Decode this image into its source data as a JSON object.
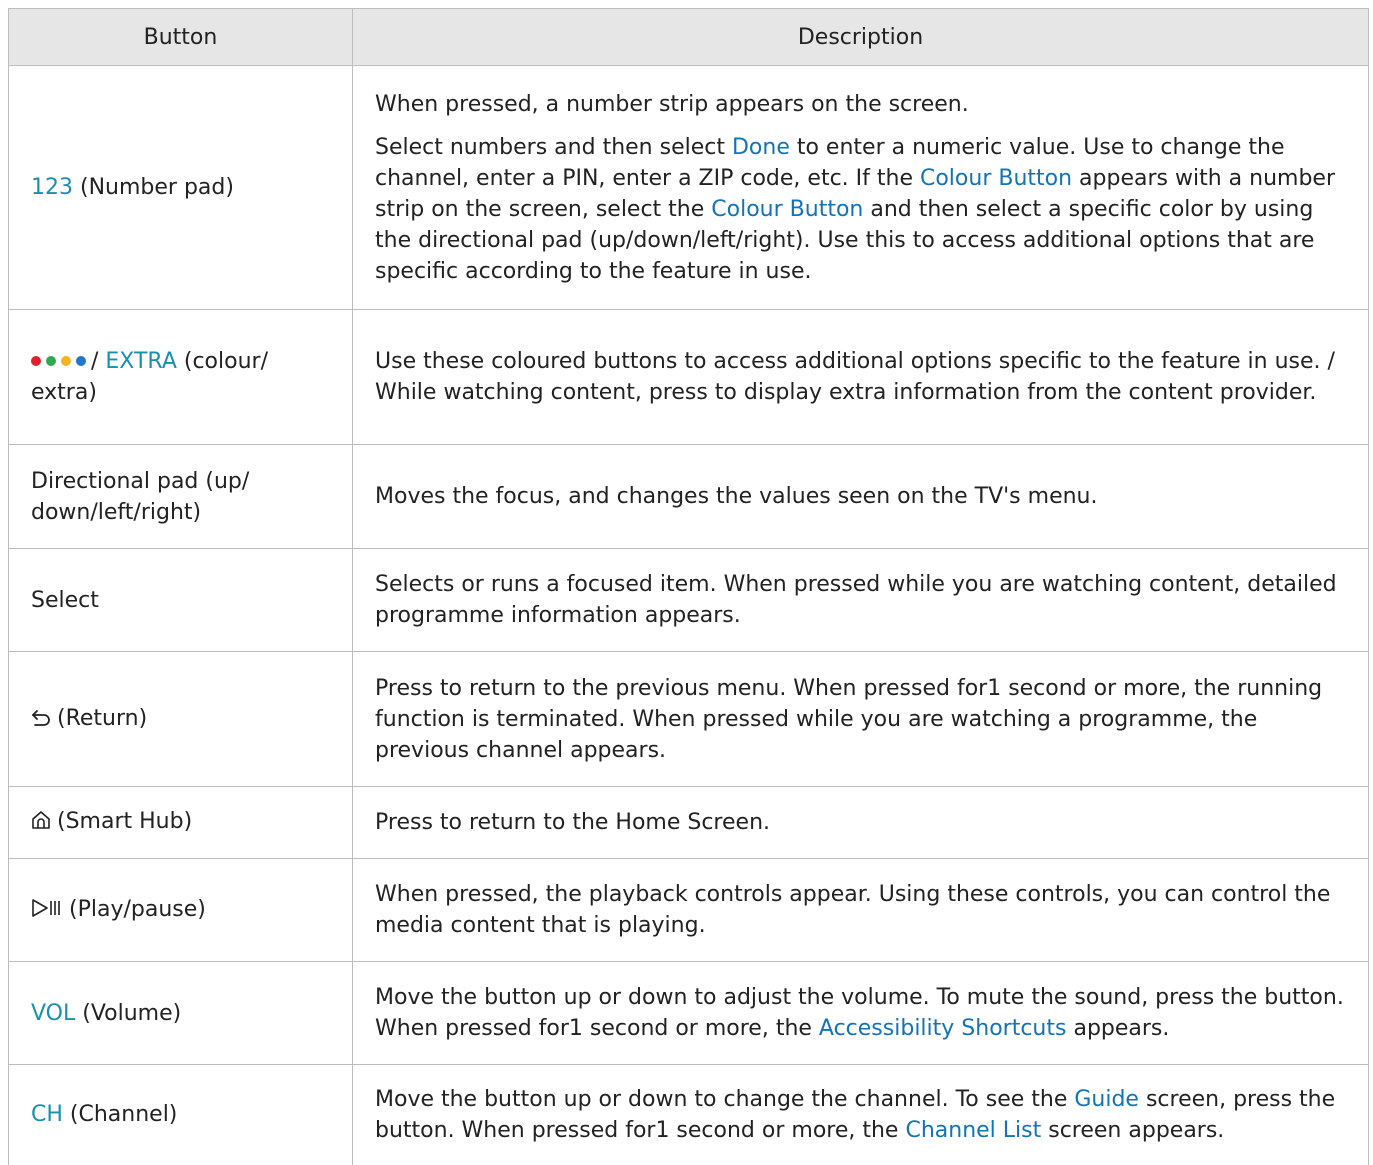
{
  "header": {
    "button_col": "Button",
    "desc_col": "Description"
  },
  "rows": [
    {
      "btn_key": "123",
      "btn_rest": " (Number pad)",
      "p1": "When pressed, a number strip appears on the screen.",
      "p2_a": "Select numbers and then select ",
      "p2_done": "Done",
      "p2_b": " to enter a numeric value. Use to change the channel, enter a PIN, enter a ZIP code, etc. If the ",
      "p2_cb1": "Colour Button",
      "p2_c": " appears with a number strip on the screen, select the ",
      "p2_cb2": "Colour Button",
      "p2_d": " and then select a specific color by using the directional pad (up/down/left/right). Use this to access additional options that are specific according to the feature in use."
    },
    {
      "dot_colors": [
        "#e0202a",
        "#2fa84f",
        "#f2b51d",
        "#1f77c9"
      ],
      "btn_sep": "/ ",
      "btn_key": "EXTRA",
      "btn_rest": " (colour/ extra)",
      "desc": "Use these coloured buttons to access additional options specific to the feature in use. / While watching content, press to display extra information from the content provider."
    },
    {
      "btn": "Directional pad (up/ down/left/right)",
      "desc": "Moves the focus, and changes the values seen on the TV's menu."
    },
    {
      "btn": "Select",
      "desc": "Selects or runs a focused item. When pressed while you are watching content, detailed programme information appears."
    },
    {
      "icon": "return-icon",
      "btn": "(Return)",
      "desc": "Press to return to the previous menu. When pressed for1 second or more, the running function is terminated. When pressed while you are watching a programme, the previous channel appears."
    },
    {
      "icon": "home-icon",
      "btn": "(Smart Hub)",
      "desc": "Press to return to the Home Screen."
    },
    {
      "icon": "play-pause-icon",
      "btn": "(Play/pause)",
      "desc": "When pressed, the playback controls appear. Using these controls, you can control the media content that is playing."
    },
    {
      "btn_key": "VOL",
      "btn_rest": " (Volume)",
      "desc_a": "Move the button up or down to adjust the volume. To mute the sound, press the button. When pressed for1 second or more, the ",
      "desc_kw": "Accessibility Shortcuts",
      "desc_b": " appears."
    },
    {
      "btn_key": "CH",
      "btn_rest": " (Channel)",
      "desc_a": "Move the button up or down to change the channel. To see the ",
      "desc_kw1": "Guide",
      "desc_b": " screen, press the button. When pressed for1 second or more, the ",
      "desc_kw2": "Channel List",
      "desc_c": " screen appears."
    }
  ],
  "colors": {
    "button_name": "#1a8fb0",
    "keyword": "#1273b5",
    "header_bg": "#e6e6e6",
    "border": "#bdbdbd"
  }
}
